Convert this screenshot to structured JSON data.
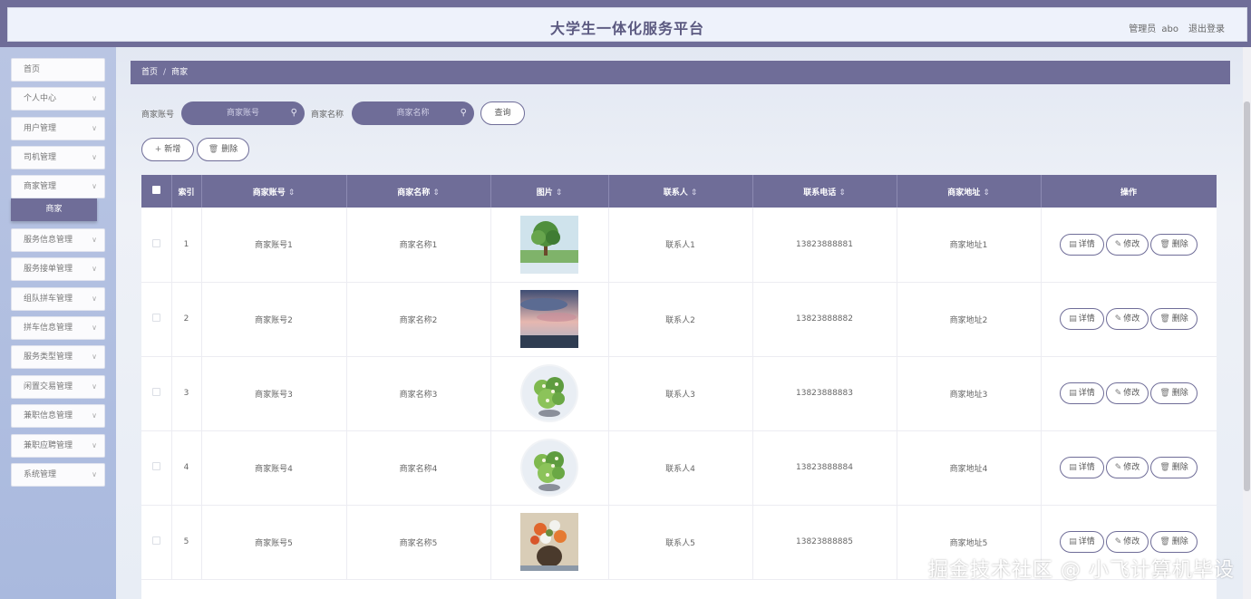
{
  "header": {
    "title": "大学生一体化服务平台",
    "role": "管理员",
    "username": "abo",
    "logout_label": "退出登录"
  },
  "sidebar": {
    "items": [
      {
        "label": "首页",
        "has_chevron": false
      },
      {
        "label": "个人中心",
        "has_chevron": true
      },
      {
        "label": "用户管理",
        "has_chevron": true
      },
      {
        "label": "司机管理",
        "has_chevron": true
      },
      {
        "label": "商家管理",
        "has_chevron": true
      },
      {
        "label": "服务信息管理",
        "has_chevron": true
      },
      {
        "label": "服务接单管理",
        "has_chevron": true
      },
      {
        "label": "组队拼车管理",
        "has_chevron": true
      },
      {
        "label": "拼车信息管理",
        "has_chevron": true
      },
      {
        "label": "服务类型管理",
        "has_chevron": true
      },
      {
        "label": "闲置交易管理",
        "has_chevron": true
      },
      {
        "label": "兼职信息管理",
        "has_chevron": true
      },
      {
        "label": "兼职应聘管理",
        "has_chevron": true
      },
      {
        "label": "系统管理",
        "has_chevron": true
      }
    ],
    "active_subitem": "商家"
  },
  "breadcrumb": {
    "home": "首页",
    "separator": "/",
    "current": "商家"
  },
  "search": {
    "account_label": "商家账号",
    "account_placeholder": "商家账号",
    "name_label": "商家名称",
    "name_placeholder": "商家名称",
    "query_button": "查询"
  },
  "actions": {
    "add_label": "新增",
    "delete_label": "删除"
  },
  "table": {
    "columns": [
      "索引",
      "商家账号",
      "商家名称",
      "图片",
      "联系人",
      "联系电话",
      "商家地址",
      "操作"
    ],
    "rows": [
      {
        "index": "1",
        "account": "商家账号1",
        "name": "商家名称1",
        "image": "landscape-tree",
        "contact": "联系人1",
        "phone": "13823888881",
        "address": "商家地址1"
      },
      {
        "index": "2",
        "account": "商家账号2",
        "name": "商家名称2",
        "image": "sunset-clouds",
        "contact": "联系人2",
        "phone": "13823888882",
        "address": "商家地址2"
      },
      {
        "index": "3",
        "account": "商家账号3",
        "name": "商家名称3",
        "image": "flower-bouquet",
        "contact": "联系人3",
        "phone": "13823888883",
        "address": "商家地址3"
      },
      {
        "index": "4",
        "account": "商家账号4",
        "name": "商家名称4",
        "image": "flower-bouquet",
        "contact": "联系人4",
        "phone": "13823888884",
        "address": "商家地址4"
      },
      {
        "index": "5",
        "account": "商家账号5",
        "name": "商家名称5",
        "image": "flower-vase",
        "contact": "联系人5",
        "phone": "13823888885",
        "address": "商家地址5"
      }
    ],
    "row_actions": {
      "detail": "详情",
      "edit": "修改",
      "delete": "删除"
    }
  },
  "watermark": "掘金技术社区 @ 小飞计算机毕设",
  "colors": {
    "primary": "#6f6d98",
    "sidebar_bg": "#b3c1e1",
    "header_bg": "#eef2fb"
  }
}
